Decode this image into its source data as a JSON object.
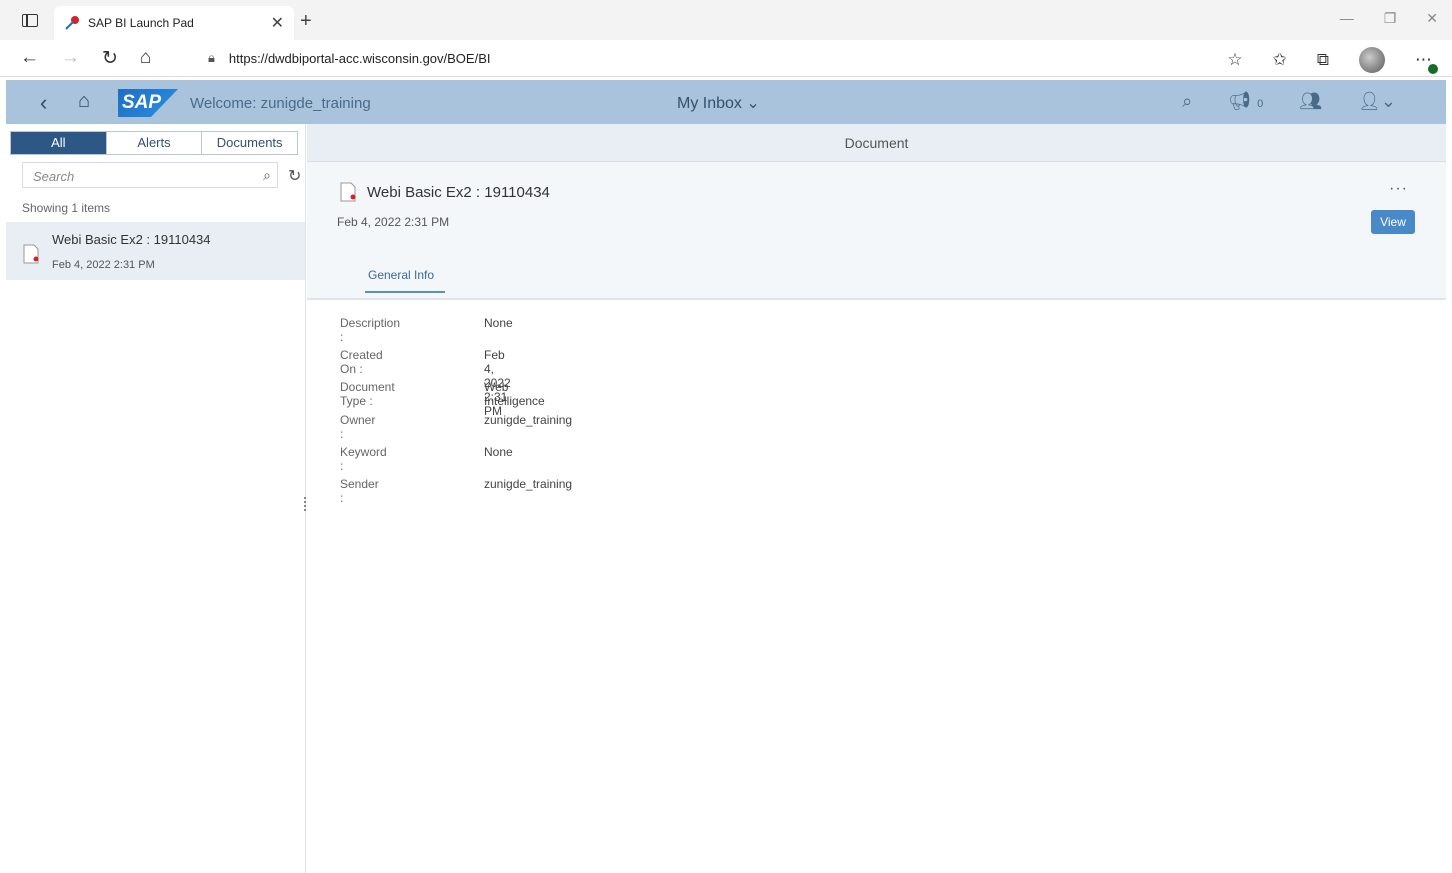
{
  "browser": {
    "tab_title": "SAP BI Launch Pad",
    "url_host": "https://dwdbiportal-acc.wisconsin.gov/BOE/BI"
  },
  "shell": {
    "welcome": "Welcome: zunigde_training",
    "inbox_title": "My Inbox",
    "notification_count": "0",
    "logo_text": "SAP"
  },
  "left_pane": {
    "filters": [
      "All",
      "Alerts",
      "Documents"
    ],
    "search_placeholder": "Search",
    "showing": "Showing 1 items",
    "items": [
      {
        "name": "Webi Basic Ex2 : 19110434",
        "date": "Feb 4, 2022 2:31 PM"
      }
    ]
  },
  "right_pane": {
    "header": "Document",
    "title": "Webi Basic Ex2 : 19110434",
    "date": "Feb 4, 2022 2:31 PM",
    "more": "···",
    "view_button": "View",
    "tab": "General Info",
    "info": [
      {
        "label": "Description :",
        "value": "None"
      },
      {
        "label": "Created On :",
        "value": "Feb 4, 2022 2:31 PM"
      },
      {
        "label": "Document Type :",
        "value": "Web Intelligence"
      },
      {
        "label": "Owner :",
        "value": "zunigde_training"
      },
      {
        "label": "Keyword :",
        "value": "None"
      },
      {
        "label": "Sender :",
        "value": "zunigde_training"
      }
    ]
  }
}
